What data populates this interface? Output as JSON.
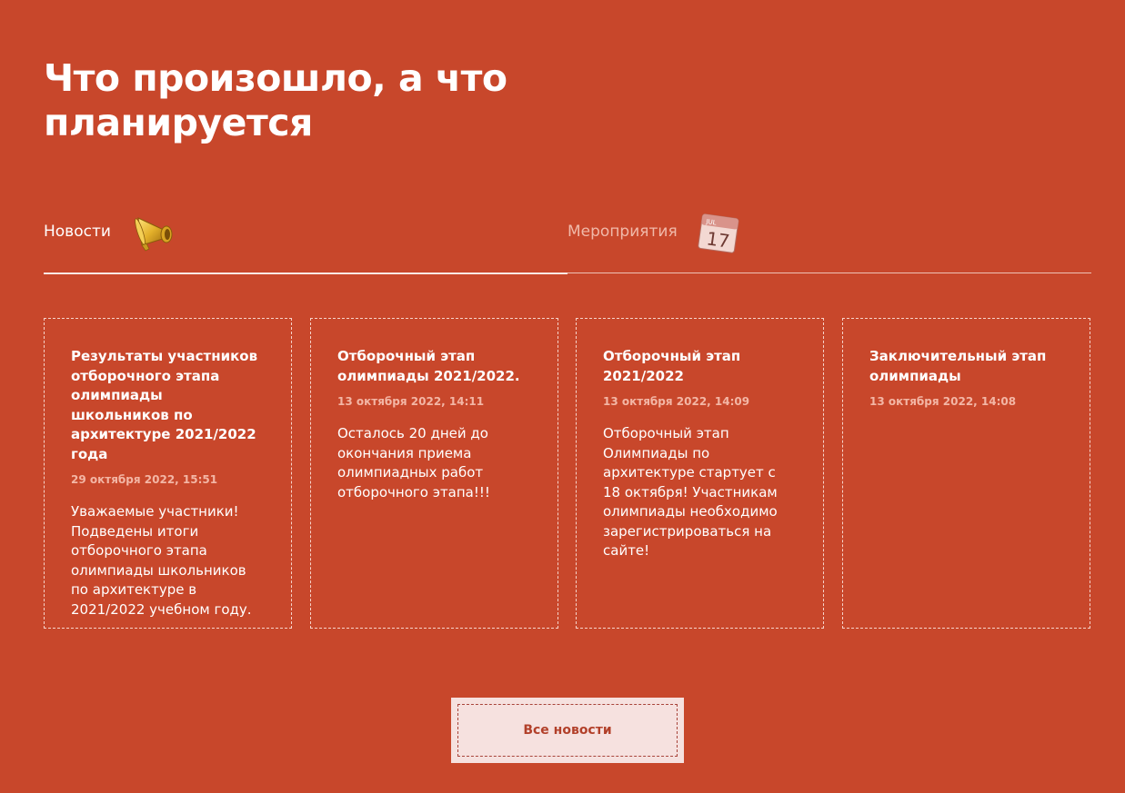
{
  "heading": "Что произошло, а что планируется",
  "tabs": [
    {
      "label": "Новости",
      "icon": "megaphone-icon",
      "active": true
    },
    {
      "label": "Мероприятия",
      "icon": "calendar-icon",
      "active": false,
      "calendar_month": "JUL",
      "calendar_day": "17"
    }
  ],
  "cards": [
    {
      "title": "Результаты участников отборочного этапа олимпиады школьников по архитектуре 2021/2022 года",
      "date": "29 октября 2022, 15:51",
      "text": "Уважаемые участники! Подведены итоги отборочного этапа олимпиады школьников по архитектуре в 2021/2022 учебном году."
    },
    {
      "title": "Отборочный этап олимпиады 2021/2022.",
      "date": "13 октября 2022, 14:11",
      "text": "Осталось 20 дней до окончания приема олимпиадных работ отборочного этапа!!!"
    },
    {
      "title": "Отборочный этап 2021/2022",
      "date": "13 октября 2022, 14:09",
      "text": "Отборочный этап Олимпиады по архитектуре стартует с 18 октября! Участникам олимпиады необходимо зарегистрироваться на сайте!"
    },
    {
      "title": "Заключительный этап олимпиады",
      "date": "13 октября 2022, 14:08",
      "text": ""
    }
  ],
  "all_news_button": "Все новости",
  "colors": {
    "background": "#c8472b",
    "button_bg": "#f6e1df",
    "button_text": "#b2402a"
  }
}
